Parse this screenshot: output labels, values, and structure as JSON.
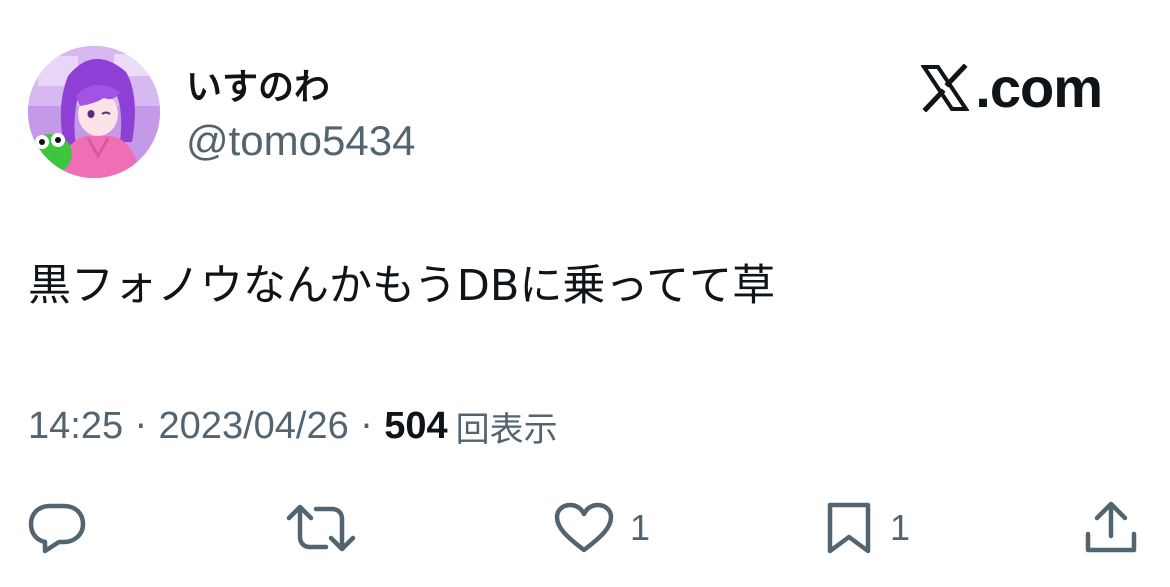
{
  "author": {
    "display_name": "いすのわ",
    "handle": "@tomo5434",
    "avatar": "illustrated purple-haired character in pink hoodie with green frog"
  },
  "brand": {
    "icon": "x-logo-icon",
    "label": ".com"
  },
  "tweet": {
    "text": "黒フォノウなんかもうDBに乗ってて草"
  },
  "meta": {
    "time": "14:25",
    "separator": "·",
    "date": "2023/04/26",
    "views_count": "504",
    "views_label": "回表示"
  },
  "actions": {
    "reply": {
      "icon": "reply-icon"
    },
    "retweet": {
      "icon": "retweet-icon"
    },
    "like": {
      "icon": "heart-icon",
      "count": "1"
    },
    "bookmark": {
      "icon": "bookmark-icon",
      "count": "1"
    },
    "share": {
      "icon": "share-icon"
    }
  },
  "colors": {
    "text_primary": "#0f1419",
    "text_secondary": "#536471",
    "background": "#ffffff"
  }
}
